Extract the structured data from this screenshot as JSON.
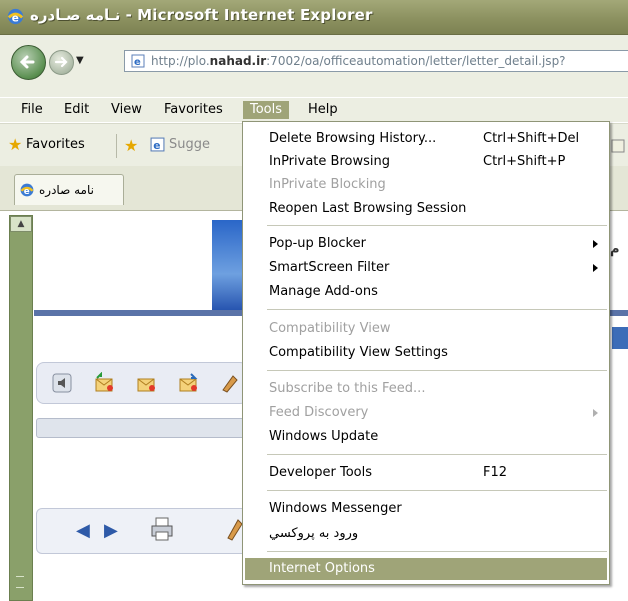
{
  "window": {
    "title": "نـامه صـادره - Microsoft Internet Explorer"
  },
  "address_bar": {
    "url_prefix": "http://plo.",
    "url_domain": "nahad.ir",
    "url_suffix": ":7002/oa/officeautomation/letter/letter_detail.jsp?"
  },
  "menu_bar": {
    "items": [
      {
        "label": "File"
      },
      {
        "label": "Edit"
      },
      {
        "label": "View"
      },
      {
        "label": "Favorites"
      },
      {
        "label": "Tools"
      },
      {
        "label": "Help"
      }
    ],
    "active": "Tools"
  },
  "favorites_bar": {
    "favorites_label": "Favorites",
    "suggested_label": "Sugge"
  },
  "tab": {
    "title": "نامه صادره"
  },
  "page_fragment": {
    "edge_letter": "م"
  },
  "tools_menu": {
    "items": [
      {
        "label": "Delete Browsing History...",
        "shortcut": "Ctrl+Shift+Del",
        "enabled": true
      },
      {
        "label": "InPrivate Browsing",
        "shortcut": "Ctrl+Shift+P",
        "enabled": true
      },
      {
        "label": "InPrivate Blocking",
        "shortcut": "",
        "enabled": false
      },
      {
        "label": "Reopen Last Browsing Session",
        "shortcut": "",
        "enabled": true
      },
      {
        "label": "Pop-up Blocker",
        "shortcut": "",
        "enabled": true,
        "submenu": true
      },
      {
        "label": "SmartScreen Filter",
        "shortcut": "",
        "enabled": true,
        "submenu": true
      },
      {
        "label": "Manage Add-ons",
        "shortcut": "",
        "enabled": true
      },
      {
        "label": "Compatibility View",
        "shortcut": "",
        "enabled": false
      },
      {
        "label": "Compatibility View Settings",
        "shortcut": "",
        "enabled": true
      },
      {
        "label": "Subscribe to this Feed...",
        "shortcut": "",
        "enabled": false
      },
      {
        "label": "Feed Discovery",
        "shortcut": "",
        "enabled": false,
        "submenu": true
      },
      {
        "label": "Windows Update",
        "shortcut": "",
        "enabled": true
      },
      {
        "label": "Developer Tools",
        "shortcut": "F12",
        "enabled": true
      },
      {
        "label": "Windows Messenger",
        "shortcut": "",
        "enabled": true
      },
      {
        "label": "ورود به پروکسي",
        "shortcut": "",
        "enabled": true
      },
      {
        "label": "Internet Options",
        "shortcut": "",
        "enabled": true,
        "highlighted": true
      }
    ]
  },
  "colors": {
    "titlebar": "#8c9160",
    "menu_highlight": "#9fa478",
    "chrome_bg": "#eceee2"
  }
}
